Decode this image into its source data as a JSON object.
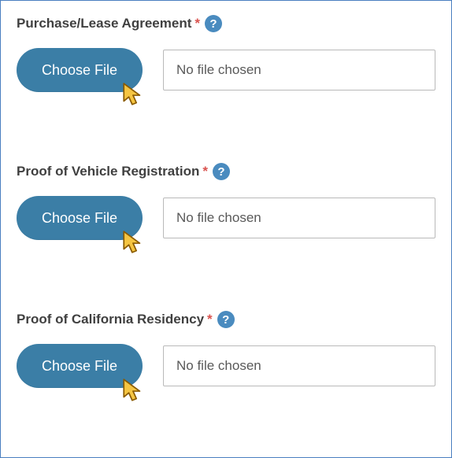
{
  "fields": [
    {
      "label": "Purchase/Lease Agreement",
      "required_mark": "*",
      "button_label": "Choose File",
      "status_text": "No file chosen"
    },
    {
      "label": "Proof of Vehicle Registration",
      "required_mark": "*",
      "button_label": "Choose File",
      "status_text": "No file chosen"
    },
    {
      "label": "Proof of California Residency",
      "required_mark": "*",
      "button_label": "Choose File",
      "status_text": "No file chosen"
    }
  ],
  "help_glyph": "?",
  "colors": {
    "accent": "#3b7ea6",
    "border": "#4a7fc0",
    "required": "#d9534f"
  }
}
